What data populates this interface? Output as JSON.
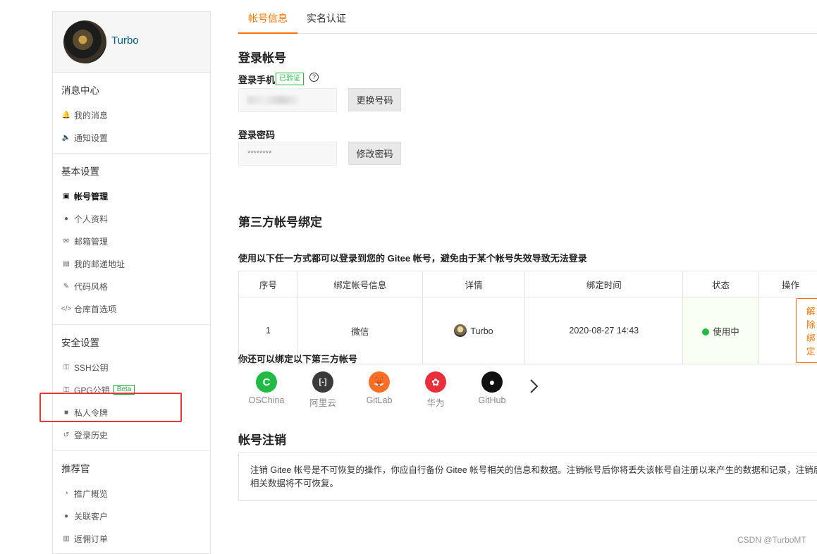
{
  "user": {
    "name": "Turbo"
  },
  "sidebar": {
    "sections": [
      {
        "title": "消息中心",
        "items": [
          {
            "label": "我的消息",
            "icon": "bell-icon"
          },
          {
            "label": "通知设置",
            "icon": "speaker-icon"
          }
        ]
      },
      {
        "title": "基本设置",
        "items": [
          {
            "label": "帐号管理",
            "icon": "id-card-icon",
            "active": true
          },
          {
            "label": "个人资料",
            "icon": "user-icon"
          },
          {
            "label": "邮箱管理",
            "icon": "envelope-icon"
          },
          {
            "label": "我的邮递地址",
            "icon": "address-card-icon"
          },
          {
            "label": "代码风格",
            "icon": "brush-icon"
          },
          {
            "label": "仓库首选项",
            "icon": "code-icon"
          }
        ]
      },
      {
        "title": "安全设置",
        "items": [
          {
            "label": "SSH公钥",
            "icon": "key-icon"
          },
          {
            "label": "GPG公钥",
            "icon": "key-icon",
            "badge": "Beta"
          },
          {
            "label": "私人令牌",
            "icon": "lock-icon"
          },
          {
            "label": "登录历史",
            "icon": "history-icon"
          }
        ]
      },
      {
        "title": "推荐官",
        "items": [
          {
            "label": "推广概览",
            "icon": "chart-icon"
          },
          {
            "label": "关联客户",
            "icon": "user-link-icon"
          },
          {
            "label": "返佣订单",
            "icon": "receipt-icon"
          }
        ]
      }
    ]
  },
  "tabs": [
    {
      "label": "帐号信息",
      "active": true
    },
    {
      "label": "实名认证"
    }
  ],
  "login": {
    "title": "登录帐号",
    "phone_label": "登录手机",
    "verified_badge": "已验证",
    "help_mark": "?",
    "change_phone_button": "更换号码",
    "password_label": "登录密码",
    "password_value": "********",
    "change_password_button": "修改密码"
  },
  "third_party": {
    "title": "第三方帐号绑定",
    "subtitle": "使用以下任一方式都可以登录到您的 Gitee 帐号，避免由于某个帐号失效导致无法登录",
    "columns": [
      "序号",
      "绑定帐号信息",
      "详情",
      "绑定时间",
      "状态",
      "操作"
    ],
    "rows": [
      {
        "index": "1",
        "account": "微信",
        "detail": "Turbo",
        "time": "2020-08-27 14:43",
        "status": "使用中",
        "action": "解除绑定"
      }
    ],
    "more_title": "你还可以绑定以下第三方帐号",
    "providers": [
      {
        "name": "OSChina",
        "icon": "oschina-icon",
        "color": "#21ba45",
        "glyph": "C"
      },
      {
        "name": "阿里云",
        "icon": "aliyun-icon",
        "color": "#3a3a3a",
        "glyph": "[-]"
      },
      {
        "name": "GitLab",
        "icon": "gitlab-icon",
        "color": "#fc6d26",
        "glyph": "🦊"
      },
      {
        "name": "华为",
        "icon": "huawei-icon",
        "color": "#e8303d",
        "glyph": "✿"
      },
      {
        "name": "GitHub",
        "icon": "github-icon",
        "color": "#111111",
        "glyph": "●"
      }
    ]
  },
  "cancel_account": {
    "title": "帐号注销",
    "notice_line1": "注销 Gitee 帐号是不可恢复的操作，你应自行备份 Gitee 帐号相关的信息和数据。注销帐号后你将丢失该帐号自注册以来产生的数据和记录，注销后",
    "notice_line2": "相关数据将不可恢复。"
  },
  "watermark": "CSDN @TurboMT",
  "colors": {
    "accent": "#fe7300",
    "success": "#21ba45",
    "highlight_box": "#e53935"
  }
}
